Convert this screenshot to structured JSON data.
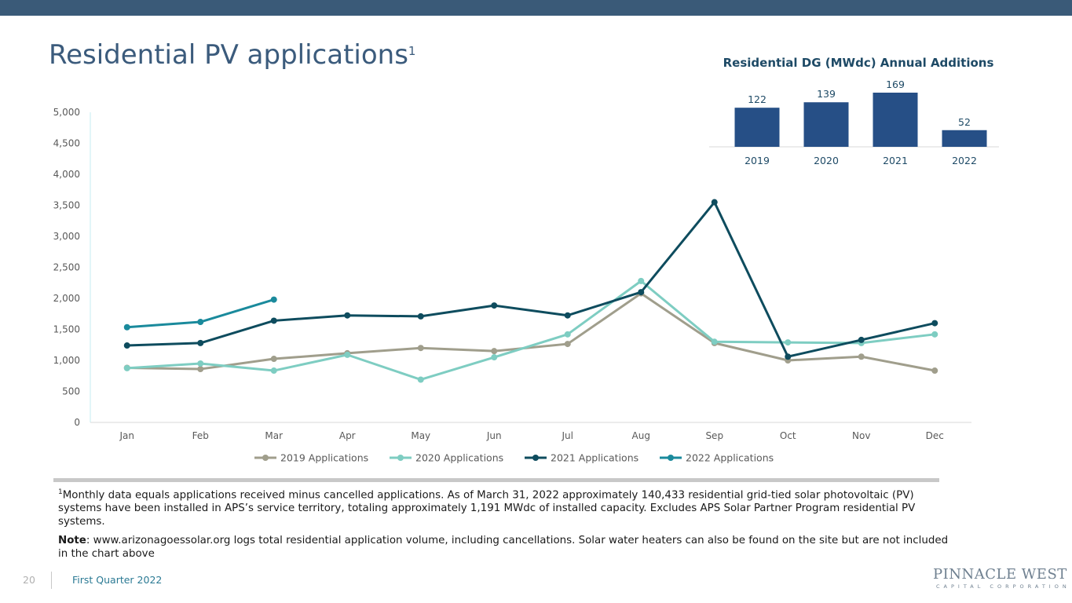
{
  "slide": {
    "title": "Residential PV applications",
    "title_superscript": "1",
    "page_number": "20",
    "footer_text": "First Quarter 2022",
    "footnote_marker": "1",
    "footnote": "Monthly data equals applications received minus cancelled applications. As of March 31, 2022 approximately 140,433 residential grid-tied solar photovoltaic (PV) systems have been installed in APS’s service territory, totaling approximately 1,191 MWdc of installed capacity.  Excludes APS Solar Partner Program residential PV systems.",
    "note_label": "Note",
    "note_text": ":  www.arizonagoessolar.org logs total residential application volume, including cancellations. Solar water heaters can also be found on the site but are not included in the chart above",
    "logo_text": "PINNACLE WEST",
    "logo_subtext": "CAPITAL CORPORATION"
  },
  "chart_data": [
    {
      "type": "line",
      "title": "",
      "xlabel": "",
      "ylabel": "",
      "categories": [
        "Jan",
        "Feb",
        "Mar",
        "Apr",
        "May",
        "Jun",
        "Jul",
        "Aug",
        "Sep",
        "Oct",
        "Nov",
        "Dec"
      ],
      "ylim": [
        0,
        5000
      ],
      "yticks": [
        0,
        500,
        1000,
        1500,
        2000,
        2500,
        3000,
        3500,
        4000,
        4500,
        5000
      ],
      "ytick_labels": [
        "0",
        "500",
        "1,000",
        "1,500",
        "2,000",
        "2,500",
        "3,000",
        "3,500",
        "4,000",
        "4,500",
        "5,000"
      ],
      "grid": false,
      "legend_position": "bottom",
      "series": [
        {
          "name": "2019 Applications",
          "color": "#a09e8c",
          "values": [
            880,
            860,
            1025,
            1115,
            1200,
            1150,
            1265,
            2080,
            1280,
            1000,
            1060,
            835
          ]
        },
        {
          "name": "2020 Applications",
          "color": "#7ecdc2",
          "values": [
            875,
            950,
            835,
            1090,
            690,
            1050,
            1420,
            2280,
            1300,
            1290,
            1280,
            1420
          ]
        },
        {
          "name": "2021 Applications",
          "color": "#0e4c5e",
          "values": [
            1240,
            1280,
            1640,
            1725,
            1710,
            1885,
            1725,
            2100,
            3550,
            1060,
            1330,
            1600
          ]
        },
        {
          "name": "2022 Applications",
          "color": "#1a8a9c",
          "values": [
            1535,
            1620,
            1980
          ]
        }
      ]
    },
    {
      "type": "bar",
      "title": "Residential DG (MWdc) Annual Additions",
      "categories": [
        "2019",
        "2020",
        "2021",
        "2022"
      ],
      "values": [
        122,
        139,
        169,
        52
      ],
      "value_labels": [
        "122",
        "139",
        "169",
        "52"
      ],
      "color": "#264f86",
      "ylim": [
        0,
        169
      ]
    }
  ]
}
